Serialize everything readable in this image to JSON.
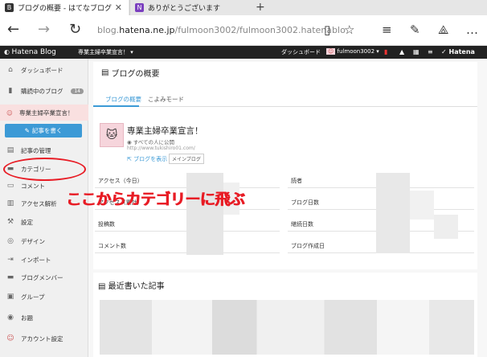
{
  "browser": {
    "tabs": [
      {
        "label": "ブログの概要 - はてなブログ",
        "active": true
      },
      {
        "label": "ありがとうございます",
        "active": false
      }
    ],
    "url_prefix": "blog.",
    "url_host": "hatena.ne.jp",
    "url_rest": "/fulmoon3002/fulmoon3002.hatenablo"
  },
  "hatena_bar": {
    "logo": "Hatena Blog",
    "blog_menu": "専業主婦卒業宣言！",
    "dashboard": "ダッシュボード",
    "user": "fulmoon3002",
    "brand": "Hatena"
  },
  "sidebar": {
    "items": [
      {
        "label": "ダッシュボード",
        "icon": "home-icon"
      },
      {
        "label": "購読中のブログ",
        "icon": "bookmark-icon",
        "badge": "14"
      }
    ],
    "selected_blog": "専業主婦卒業宣言！",
    "write_button": "記事を書く",
    "menu": [
      {
        "label": "記事の管理",
        "icon": "document-icon"
      },
      {
        "label": "カテゴリー",
        "icon": "folder-icon"
      },
      {
        "label": "コメント",
        "icon": "comment-icon"
      },
      {
        "label": "アクセス解析",
        "icon": "chart-icon"
      },
      {
        "label": "設定",
        "icon": "wrench-icon"
      },
      {
        "label": "デザイン",
        "icon": "palette-icon"
      },
      {
        "label": "インポート",
        "icon": "import-icon"
      },
      {
        "label": "ブログメンバー",
        "icon": "members-icon"
      },
      {
        "label": "グループ",
        "icon": "group-icon"
      },
      {
        "label": "お題",
        "icon": "topic-icon"
      },
      {
        "label": "アカウント設定",
        "icon": "account-icon"
      }
    ]
  },
  "main": {
    "title": "ブログの概要",
    "tabs": [
      "ブログの概要",
      "こよみモード"
    ],
    "blog_name": "専業主婦卒業宣言！",
    "visibility": "すべての人に公開",
    "blog_url": "http://www.tukishiro01.com/",
    "view_blog": "ブログを表示",
    "main_blog": "メインブログ",
    "stats_left": [
      "アクセス（今日）",
      "アクセス（累計）",
      "投稿数",
      "コメント数"
    ],
    "stats_right": [
      "読者",
      "ブログ日数",
      "継続日数",
      "ブログ作成日"
    ],
    "recent_title": "最近書いた記事"
  },
  "annotation": {
    "text": "ここからカテゴリーに飛ぶ",
    "color": "#e81c25"
  },
  "colors": {
    "accent": "#3c9ad6",
    "hatena_bar": "#222222"
  }
}
